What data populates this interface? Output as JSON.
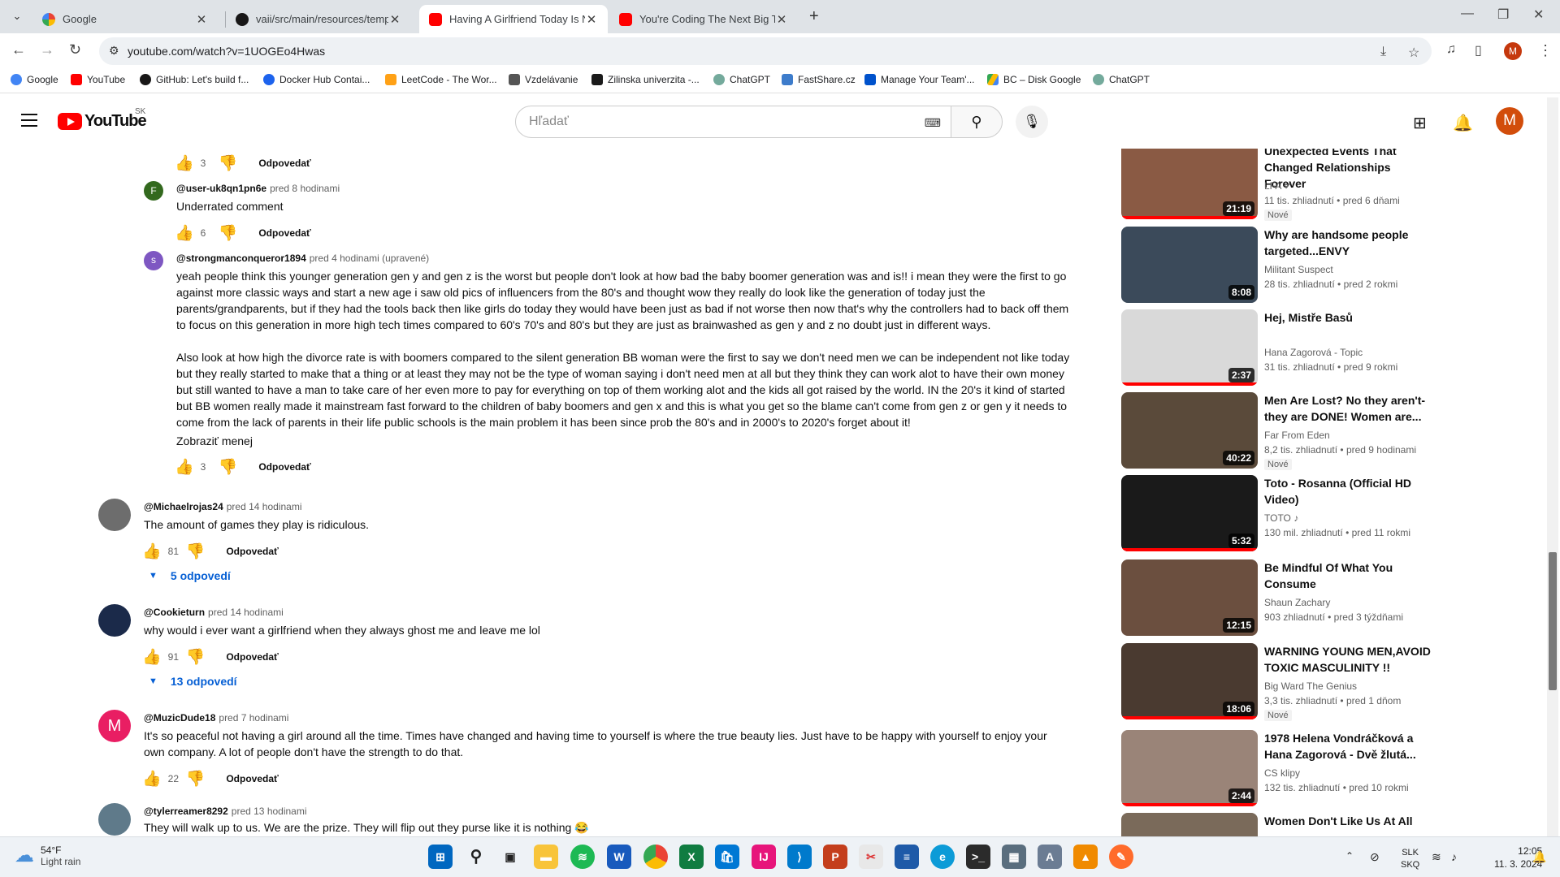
{
  "browser": {
    "tabs": [
      {
        "title": "Google",
        "active": false,
        "favicon_color": "#4285f4"
      },
      {
        "title": "vaii/src/main/resources/templa",
        "active": false,
        "favicon_color": "#181717"
      },
      {
        "title": "Having A Girlfriend Today Is No",
        "active": true,
        "favicon_color": "#ff0000"
      },
      {
        "title": "You're Coding The Next Big Thi",
        "active": false,
        "favicon_color": "#ff0000"
      }
    ],
    "url": "youtube.com/watch?v=1UOGEo4Hwas",
    "bookmarks": [
      {
        "label": "Google",
        "color": "#4285f4"
      },
      {
        "label": "YouTube",
        "color": "#ff0000"
      },
      {
        "label": "GitHub: Let's build f...",
        "color": "#181717"
      },
      {
        "label": "Docker Hub Contai...",
        "color": "#1d63ed"
      },
      {
        "label": "LeetCode - The Wor...",
        "color": "#ffa116"
      },
      {
        "label": "Vzdelávanie",
        "color": "#555555"
      },
      {
        "label": "Zilinska univerzita -...",
        "color": "#1a1a1a"
      },
      {
        "label": "ChatGPT",
        "color": "#74aa9c"
      },
      {
        "label": "FastShare.cz",
        "color": "#3d7ccb"
      },
      {
        "label": "Manage Your Team'...",
        "color": "#0052cc"
      },
      {
        "label": "BC – Disk Google",
        "color": "#fbbc04"
      },
      {
        "label": "ChatGPT",
        "color": "#74aa9c"
      }
    ],
    "profile_initial": "M"
  },
  "youtube": {
    "logo_text": "YouTube",
    "country_code": "SK",
    "search_placeholder": "Hľadať",
    "avatar_initial": "M"
  },
  "comments": [
    {
      "type": "reply-actions",
      "likes": "3",
      "reply_label": "Odpovedať"
    },
    {
      "type": "reply",
      "author": "@user-uk8qn1pn6e",
      "time": "pred 8 hodinami",
      "avatar_letter": "F",
      "avatar_color": "#33691e",
      "text": [
        "Underrated comment"
      ],
      "likes": "6",
      "reply_label": "Odpovedať"
    },
    {
      "type": "reply",
      "author": "@strongmanconqueror1894",
      "time": "pred 4 hodinami (upravené)",
      "avatar_letter": "s",
      "avatar_color": "#7e57c2",
      "text": [
        "yeah people think this younger generation gen y and gen z is the worst but people don't look at how bad the baby boomer generation was and is!!    i mean they were the first to go against more classic ways and start a new age i saw old pics of influencers from the 80's and thought wow they really do look like the generation of today just the parents/grandparents, but if they had the tools back then like girls do today they would have been just as bad if not worse then now that's why the controllers had to back off them to focus on this generation in more high tech times compared to 60's 70's and 80's but they are just as brainwashed as gen y and z no doubt just in different ways.",
        "Also look at how high the divorce rate is with boomers compared to the silent generation BB woman were the first to say we don't need men we can be independent not like today but they really started to make that a thing or at least they may not be the type of woman saying i don't need men at all  but they think they can work alot to have their own money but still wanted to have a man to take care of her even more to pay for everything on top of them working alot and the kids all got raised by the world. IN the 20's it kind of started but BB women really made it mainstream fast forward to the children of baby boomers and gen x and this is what you get so the blame can't come from gen z or gen y it needs to come from the lack of parents in their life public schools is the main problem it has been since prob the 80's and in 2000's to 2020's forget about it!"
      ],
      "show_less": "Zobraziť menej",
      "likes": "3",
      "reply_label": "Odpovedať"
    },
    {
      "type": "top",
      "author": "@Michaelrojas24",
      "time": "pred 14 hodinami",
      "avatar_color": "#6d6d6d",
      "text": [
        "The amount of games they play is ridiculous."
      ],
      "likes": "81",
      "reply_label": "Odpovedať",
      "replies": "5 odpovedí"
    },
    {
      "type": "top",
      "author": "@Cookieturn",
      "time": "pred 14 hodinami",
      "avatar_color": "#1b2a4a",
      "text": [
        "why would i ever want a girlfriend when they always ghost me and leave me lol"
      ],
      "likes": "91",
      "reply_label": "Odpovedať",
      "replies": "13 odpovedí"
    },
    {
      "type": "top",
      "author": "@MuzicDude18",
      "time": "pred 7 hodinami",
      "avatar_letter": "M",
      "avatar_color": "#e91e63",
      "text": [
        "It's so peaceful not having a girl around all the time. Times have changed and having time to yourself is where the true beauty lies. Just have to be happy with yourself to enjoy your own company. A lot of people don't have the strength to do that."
      ],
      "likes": "22",
      "reply_label": "Odpovedať"
    },
    {
      "type": "top",
      "author": "@tylerreamer8292",
      "time": "pred 13 hodinami",
      "avatar_color": "#5f7a8a",
      "text": [
        "They will walk up to us. We are the prize. They will flip out they purse like it is nothing 😂"
      ]
    }
  ],
  "recommendations": [
    {
      "title": "Unexpected Events That Changed Relationships Forever",
      "channel": "LFA",
      "verified": true,
      "views": "11 tis. zhliadnutí",
      "age": "pred 6 dňami",
      "badge": "Nové",
      "duration": "21:19",
      "thumb_color": "#8a5a44",
      "progress": 1.0
    },
    {
      "title": "Why are handsome people targeted...ENVY",
      "channel": "Militant Suspect",
      "views": "28 tis. zhliadnutí",
      "age": "pred 2 rokmi",
      "duration": "8:08",
      "thumb_color": "#3b4a5a",
      "progress": 0.0
    },
    {
      "title": "Hej, Mistře Basů",
      "channel": "Hana Zagorová - Topic",
      "views": "31 tis. zhliadnutí",
      "age": "pred 9 rokmi",
      "duration": "2:37",
      "thumb_color": "#d9d9d9",
      "progress": 1.0
    },
    {
      "title": "Men Are Lost? No they aren't- they are DONE! Women are...",
      "channel": "Far From Eden",
      "views": "8,2 tis. zhliadnutí",
      "age": "pred 9 hodinami",
      "badge": "Nové",
      "duration": "40:22",
      "thumb_color": "#5a4a3a",
      "progress": 0.0
    },
    {
      "title": "Toto - Rosanna (Official HD Video)",
      "channel": "TOTO",
      "music": true,
      "views": "130 mil. zhliadnutí",
      "age": "pred 11 rokmi",
      "duration": "5:32",
      "thumb_color": "#1a1a1a",
      "progress": 1.0
    },
    {
      "title": "Be Mindful Of What You Consume",
      "channel": "Shaun Zachary",
      "views": "903 zhliadnutí",
      "age": "pred 3 týždňami",
      "duration": "12:15",
      "thumb_color": "#6b4f3f",
      "progress": 0.0
    },
    {
      "title": "WARNING YOUNG MEN,AVOID TOXIC MASCULINITY !!",
      "channel": "Big Ward The Genius",
      "views": "3,3 tis. zhliadnutí",
      "age": "pred 1 dňom",
      "badge": "Nové",
      "duration": "18:06",
      "thumb_color": "#4a3a30",
      "progress": 1.0
    },
    {
      "title": "1978 Helena Vondráčková a Hana Zagorová - Dvě žlutá...",
      "channel": "CS klipy",
      "views": "132 tis. zhliadnutí",
      "age": "pred 10 rokmi",
      "duration": "2:44",
      "thumb_color": "#9a8478",
      "progress": 1.0
    },
    {
      "title": "Women Don't Like Us At All",
      "channel": "",
      "views": "",
      "age": "",
      "duration": "",
      "thumb_color": "#7a6a5a",
      "progress": 0.0
    }
  ],
  "taskbar": {
    "temperature": "54°F",
    "weather": "Light rain",
    "language": "SLK",
    "layout": "SKQ",
    "time": "12:05",
    "date": "11. 3. 2024"
  }
}
